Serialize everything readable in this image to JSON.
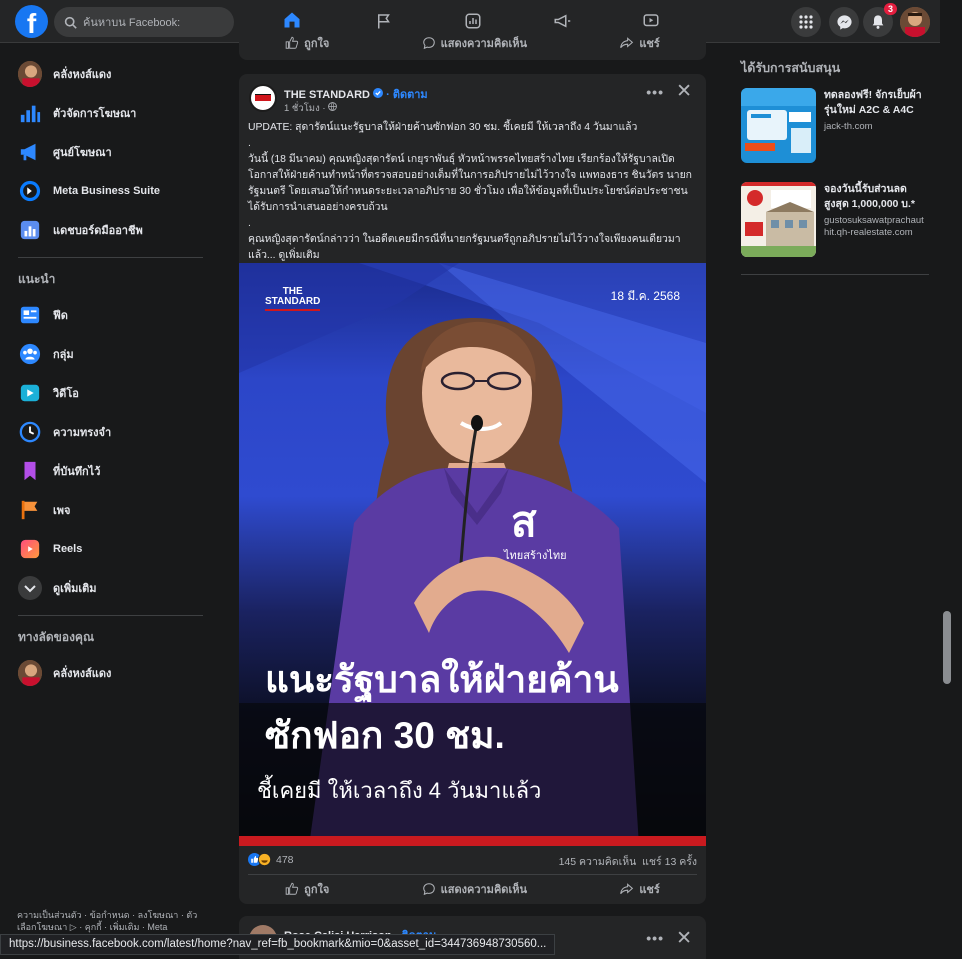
{
  "search": {
    "placeholder": "ค้นหาบน Facebook:"
  },
  "top": {
    "notifications_count": "3"
  },
  "leftnav": {
    "items": [
      {
        "label": "คลั่งหงส์แดง"
      },
      {
        "label": "ตัวจัดการโฆษณา"
      },
      {
        "label": "ศูนย์โฆษณา"
      },
      {
        "label": "Meta Business Suite"
      },
      {
        "label": "แดชบอร์ดมืออาชีพ"
      }
    ],
    "section_recommended": "แนะนำ",
    "recommended": [
      {
        "label": "ฟีด"
      },
      {
        "label": "กลุ่ม"
      },
      {
        "label": "วิดีโอ"
      },
      {
        "label": "ความทรงจำ"
      },
      {
        "label": "ที่บันทึกไว้"
      },
      {
        "label": "เพจ"
      },
      {
        "label": "Reels"
      },
      {
        "label": "ดูเพิ่มเติม"
      }
    ],
    "section_shortcuts": "ทางลัดของคุณ",
    "shortcuts": [
      {
        "label": "คลั่งหงส์แดง"
      }
    ]
  },
  "footer": {
    "text": "ความเป็นส่วนตัว · ข้อกำหนด · ลงโฆษณา · ตัวเลือกโฆษณา ▷ · คุกกี้ · เพิ่มเติม · Meta"
  },
  "status_url": "https://business.facebook.com/latest/home?nav_ref=fb_bookmark&mio=0&asset_id=344736948730560...",
  "actions": {
    "like": "ถูกใจ",
    "comment": "แสดงความคิดเห็น",
    "share": "แชร์"
  },
  "post": {
    "page_name": "THE STANDARD",
    "follow": "· ติดตาม",
    "time": "1 ชั่วโมง ·",
    "text_lines": [
      "UPDATE: สุดารัตน์แนะรัฐบาลให้ฝ่ายค้านซักฟอก 30 ชม. ชี้เคยมี ให้เวลาถึง 4 วันมาแล้ว",
      ".",
      "วันนี้ (18 มีนาคม) คุณหญิงสุดารัตน์ เกยุราพันธุ์ หัวหน้าพรรคไทยสร้างไทย เรียกร้องให้รัฐบาลเปิดโอกาสให้ฝ่ายค้านทำหน้าที่ตรวจสอบอย่างเต็มที่ในการอภิปรายไม่ไว้วางใจ แพทองธาร ชินวัตร นายกรัฐมนตรี โดยเสนอให้กำหนดระยะเวลาอภิปราย 30 ชั่วโมง เพื่อให้ข้อมูลที่เป็นประโยชน์ต่อประชาชนได้รับการนำเสนออย่างครบถ้วน",
      ".",
      "คุณหญิงสุดารัตน์กล่าวว่า ในอดีตเคยมีกรณีที่นายกรัฐมนตรีถูกอภิปรายไม่ไว้วางใจเพียงคนเดียวมาแล้ว... ดูเพิ่มเติม"
    ],
    "image": {
      "logo_line1": "THE",
      "logo_line2": "STANDARD",
      "date": "18 มี.ค. 2568",
      "shirt_letter": "ส",
      "shirt_text": "ไทยสร้างไทย",
      "headline1": "แนะรัฐบาลให้ฝ่ายค้าน",
      "headline2": "ซักฟอก 30 ชม.",
      "subhead": "ชี้เคยมี ให้เวลาถึง 4 วันมาแล้ว"
    },
    "reactions_count": "478",
    "comments": "145 ความคิดเห็น",
    "shares": "แชร์ 13 ครั้ง"
  },
  "next_post": {
    "name": "Rose Calisi Harrison",
    "follow": "· ติดตาม"
  },
  "right": {
    "sponsored": "ได้รับการสนับสนุน",
    "ads": [
      {
        "title": "ทดลองฟรี! จักรเย็บผ้ารุ่นใหม่ A2C & A4C",
        "domain": "jack-th.com"
      },
      {
        "title": "จองวันนี้รับส่วนลดสูงสุด 1,000,000 บ.*",
        "domain": "gustosuksawatprachauthit.qh-realestate.com"
      }
    ]
  },
  "colors": {
    "accent": "#1877f2",
    "link": "#2d88ff",
    "bg": "#18191a",
    "card": "#242526",
    "badge": "#e41e3f"
  }
}
